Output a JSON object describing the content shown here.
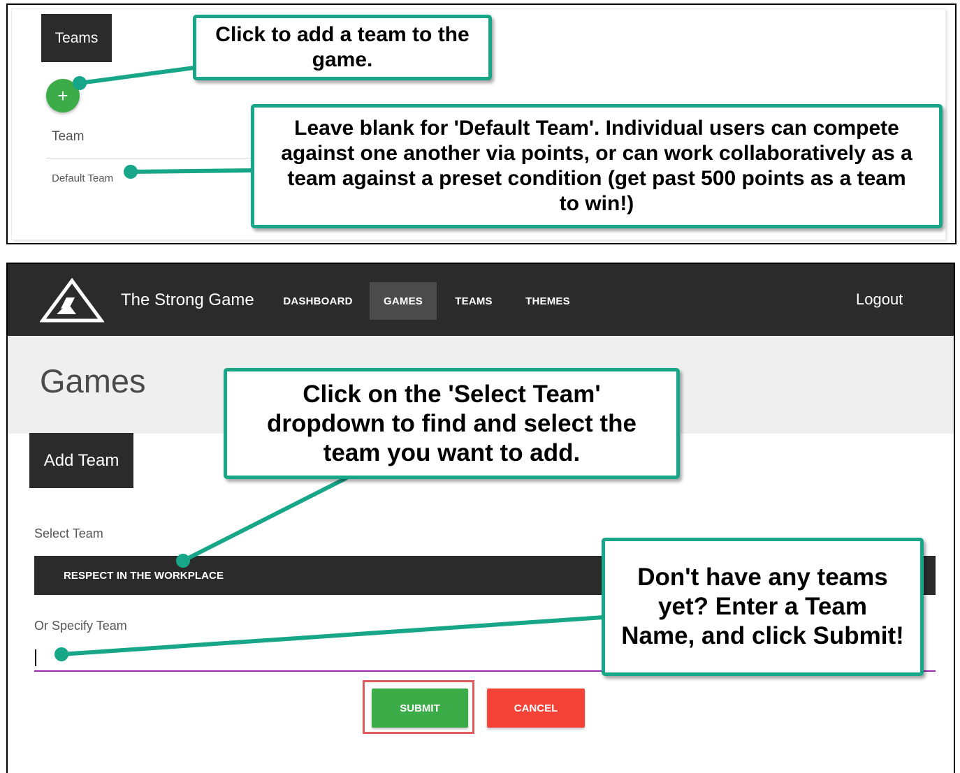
{
  "top_panel": {
    "tab_label": "Teams",
    "add_button_symbol": "+",
    "table": {
      "header": "Team",
      "rows": [
        "Default Team"
      ]
    }
  },
  "navbar": {
    "brand": "The Strong Game",
    "logo_icon": "mountain-triangle-icon",
    "items": [
      "DASHBOARD",
      "GAMES",
      "TEAMS",
      "THEMES"
    ],
    "active_item": "GAMES",
    "logout": "Logout"
  },
  "page": {
    "title": "Games",
    "tab_label": "Add Team",
    "select_label": "Select Team",
    "select_value": "RESPECT IN THE WORKPLACE",
    "specify_label": "Or Specify Team",
    "specify_value": "",
    "submit_label": "SUBMIT",
    "cancel_label": "CANCEL"
  },
  "callouts": {
    "add_team": "Click to add a team to the game.",
    "default_team": "Leave blank for 'Default Team'. Individual users can compete against one another via points, or can work collaboratively as a team against a preset condition (get past 500 points as a team to win!)",
    "select_team": "Click on the 'Select Team' dropdown to find and select the team you want to add.",
    "no_teams": "Don't have any teams yet?  Enter a Team Name, and click Submit!"
  },
  "colors": {
    "callout_border": "#18a688",
    "dark_bar": "#2b2b2b",
    "submit": "#3cac49",
    "cancel": "#f44336",
    "input_underline": "#9c27b0",
    "highlight": "#e05b5b"
  }
}
